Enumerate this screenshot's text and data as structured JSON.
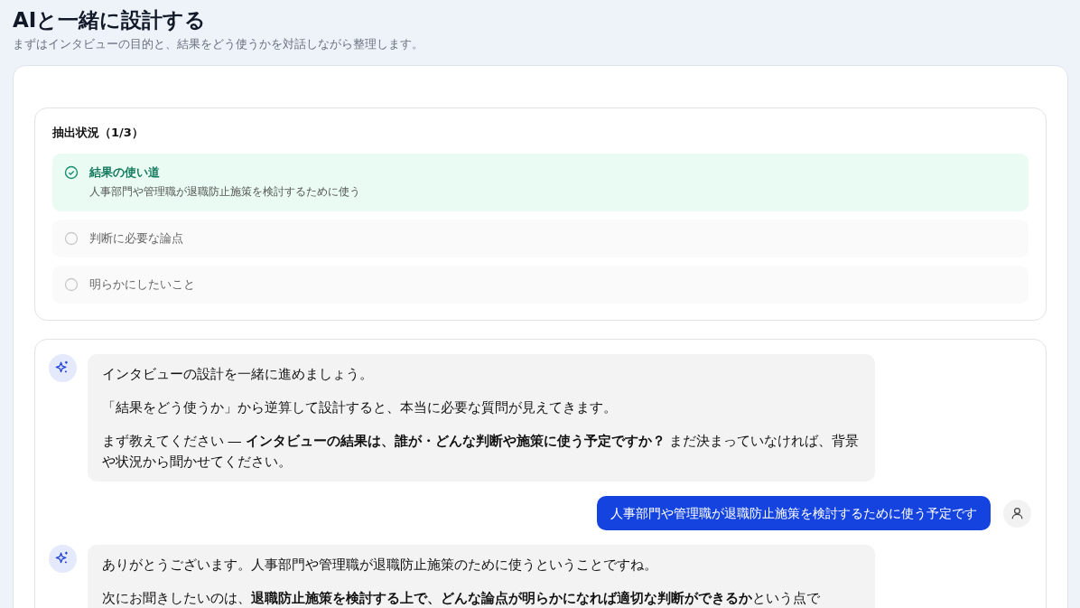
{
  "header": {
    "title": "AIと一緒に設計する",
    "subtitle": "まずはインタビューの目的と、結果をどう使うかを対話しながら整理します。"
  },
  "extraction": {
    "title": "抽出状況（1/3）",
    "items": [
      {
        "label": "結果の使い道",
        "done": true,
        "detail": "人事部門や管理職が退職防止施策を検討するために使う"
      },
      {
        "label": "判断に必要な論点",
        "done": false
      },
      {
        "label": "明らかにしたいこと",
        "done": false
      }
    ]
  },
  "messages": [
    {
      "kind": "ai",
      "paragraphs": [
        "インタビューの設計を一緒に進めましょう。",
        "「結果をどう使うか」から逆算して設計すると、本当に必要な質問が見えてきます。",
        "まず教えてください ― **インタビューの結果は、誰が・どんな判断や施策に使う予定ですか？** まだ決まっていなければ、背景や状況から聞かせてください。"
      ]
    },
    {
      "kind": "user",
      "paragraphs": [
        "人事部門や管理職が退職防止施策を検討するために使う予定です"
      ]
    },
    {
      "kind": "ai",
      "paragraphs": [
        "ありがとうございます。人事部門や管理職が退職防止施策のために使うということですね。",
        "次にお聞きしたいのは、**退職防止施策を検討する上で、どんな論点が明らかになれば適切な判断ができるか**という点で"
      ]
    }
  ]
}
